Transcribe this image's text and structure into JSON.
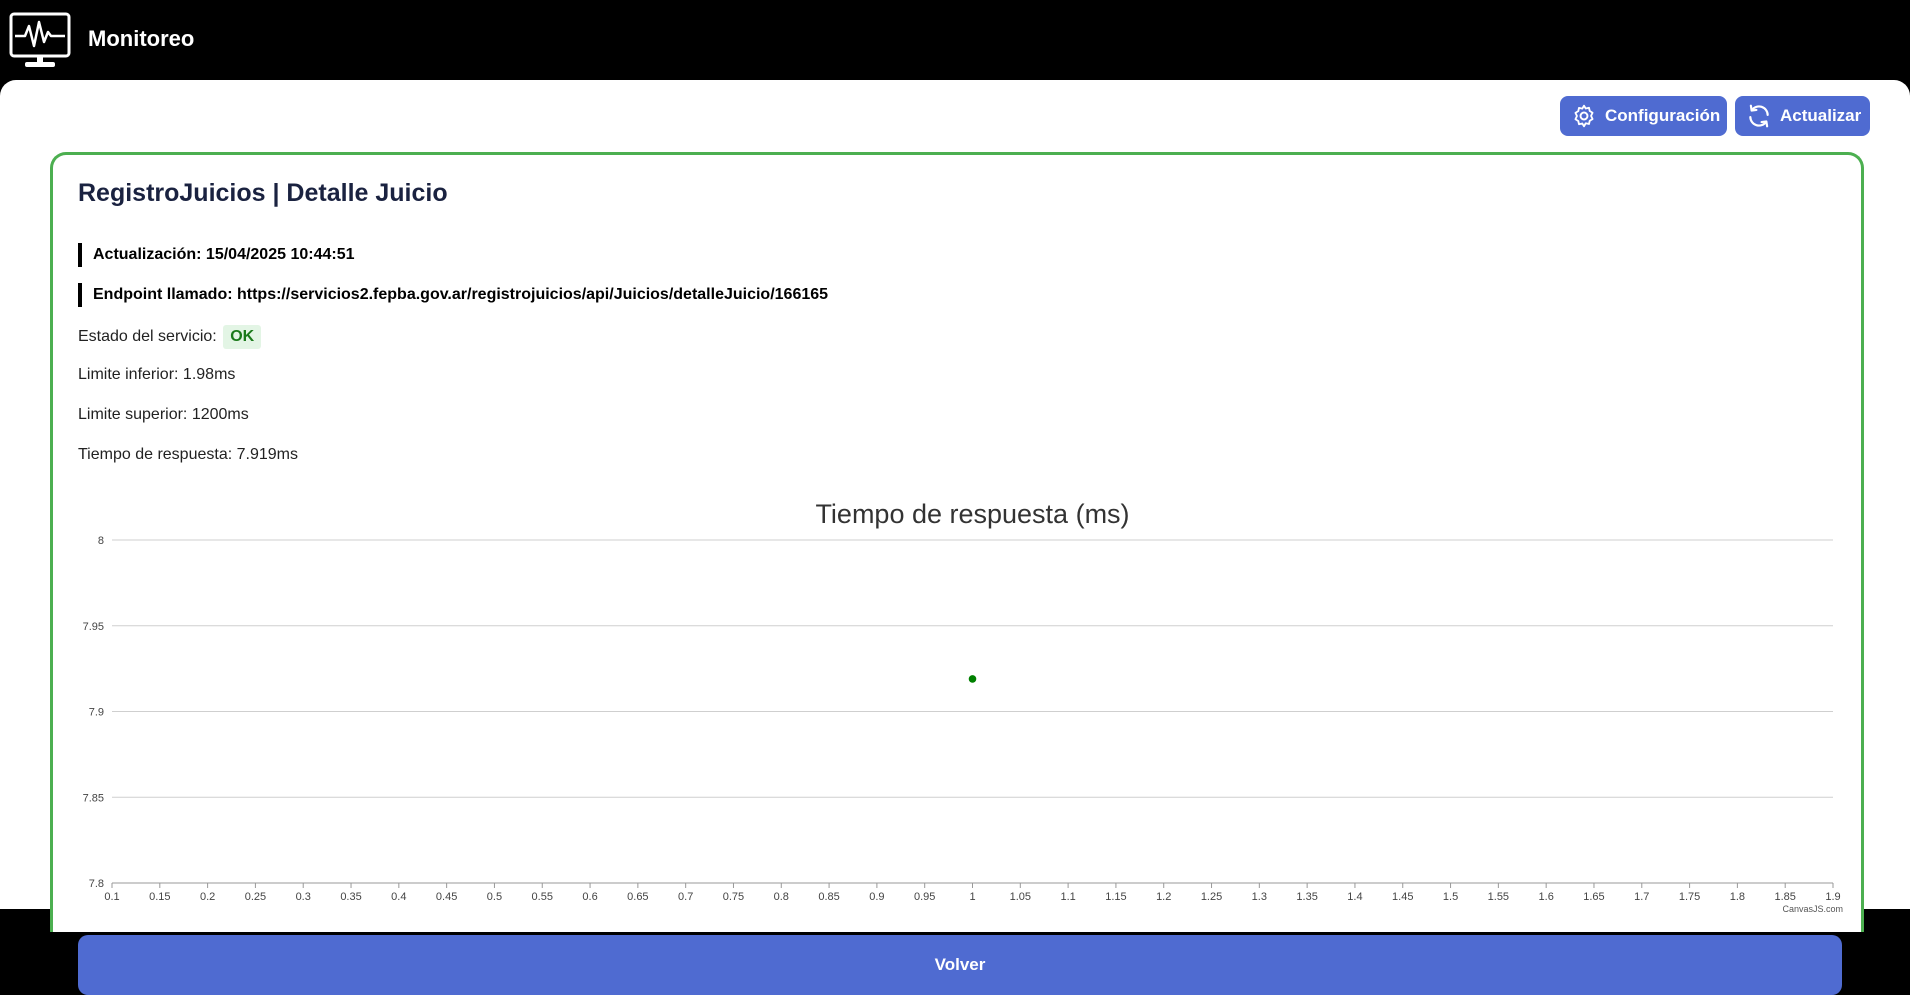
{
  "header": {
    "app_title": "Monitoreo",
    "logo_icon": "monitor-heartbeat-icon"
  },
  "toolbar": {
    "config_label": "Configuración",
    "config_icon": "gear-icon",
    "refresh_label": "Actualizar",
    "refresh_icon": "refresh-icon"
  },
  "service": {
    "title": "RegistroJuicios | Detalle Juicio",
    "update_label": "Actualización:",
    "update_value": "15/04/2025 10:44:51",
    "endpoint_label": "Endpoint llamado:",
    "endpoint_value": "https://servicios2.fepba.gov.ar/registrojuicios/api/Juicios/detalleJuicio/166165",
    "status_label": "Estado del servicio:",
    "status_value": "OK",
    "lower_limit": "Limite inferior: 1.98ms",
    "upper_limit": "Limite superior: 1200ms",
    "response_time": "Tiempo de respuesta: 7.919ms"
  },
  "chart_data": {
    "type": "scatter",
    "title": "Tiempo de respuesta (ms)",
    "xlim": [
      0.1,
      1.9
    ],
    "ylim": [
      7.8,
      8
    ],
    "x_ticks": [
      "0.1",
      "0.15",
      "0.2",
      "0.25",
      "0.3",
      "0.35",
      "0.4",
      "0.45",
      "0.5",
      "0.55",
      "0.6",
      "0.65",
      "0.7",
      "0.75",
      "0.8",
      "0.85",
      "0.9",
      "0.95",
      "1",
      "1.05",
      "1.1",
      "1.15",
      "1.2",
      "1.25",
      "1.3",
      "1.35",
      "1.4",
      "1.45",
      "1.5",
      "1.55",
      "1.6",
      "1.65",
      "1.7",
      "1.75",
      "1.8",
      "1.85",
      "1.9"
    ],
    "y_ticks": [
      "7.8",
      "7.85",
      "7.9",
      "7.95",
      "8"
    ],
    "series": [
      {
        "points": [
          {
            "x": 1,
            "y": 7.919
          }
        ],
        "color": "#008000"
      }
    ],
    "grid": true,
    "credit": "CanvasJS.com"
  },
  "footer": {
    "back_label": "Volver"
  },
  "colors": {
    "accent": "#4f6bd1",
    "card_border": "#4caf50",
    "ok": "#1b7a1b"
  }
}
